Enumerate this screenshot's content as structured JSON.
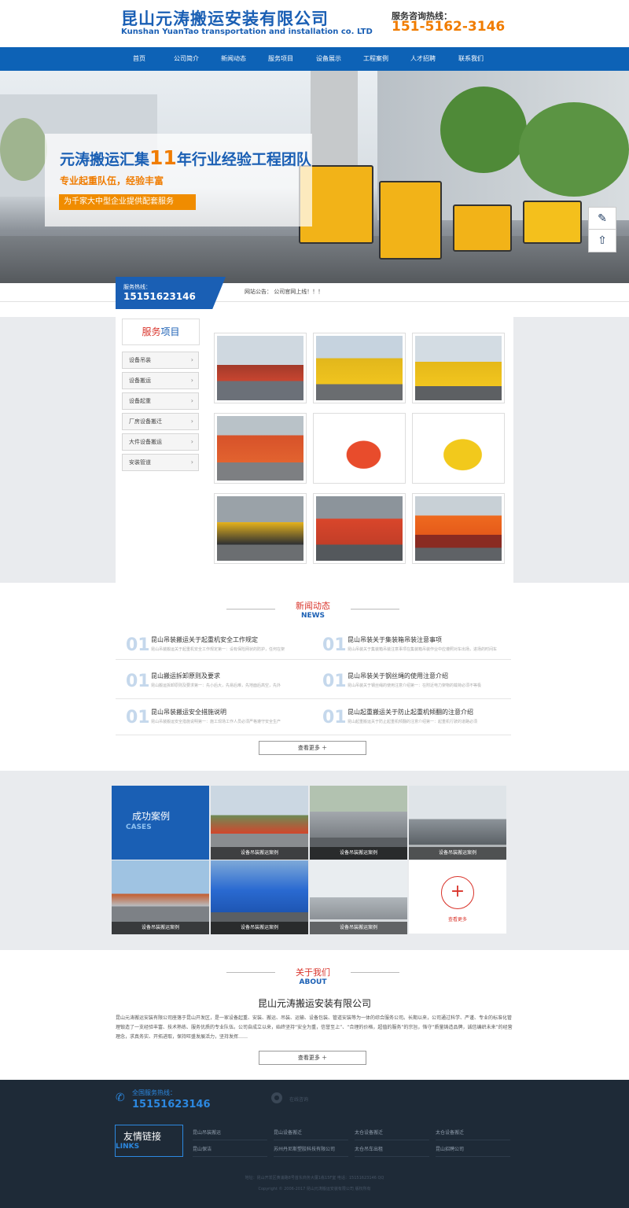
{
  "header": {
    "company_cn": "昆山元涛搬运安装有限公司",
    "company_en": "Kunshan YuanTao transportation and installation co. LTD",
    "hotline_label": "服务咨询热线：",
    "hotline_number": "151-5162-3146"
  },
  "nav": [
    "首页",
    "公司简介",
    "新闻动态",
    "服务项目",
    "设备展示",
    "工程案例",
    "人才招聘",
    "联系我们"
  ],
  "banner": {
    "title_pre": "元涛搬运汇集",
    "title_num": "11",
    "title_post": "年行业经验工程团队",
    "subtitle": "专业起重队伍，经验丰富",
    "badge": "为千家大中型企业提供配套服务"
  },
  "hotline_bar": {
    "label": "服务热线：",
    "number": "15151623146",
    "notice": "网站公告：  公司官网上线！！！"
  },
  "services": {
    "title_red": "服务",
    "title_blue": "项目",
    "items": [
      "设备吊装",
      "设备搬运",
      "设备起重",
      "厂房设备搬迁",
      "大件设备搬运",
      "安装管道"
    ]
  },
  "news": {
    "title_cn": "新闻动态",
    "title_en": "NEWS",
    "items": [
      {
        "num": "01",
        "title": "昆山吊装搬运关于起重机安全工作规定",
        "desc": "昆山吊装搬运关于起重机安全工作规定第一：设有保险网状的防护，任何在架"
      },
      {
        "num": "01",
        "title": "昆山吊装关于集装箱吊装注意事项",
        "desc": "昆山吊装关于集装箱吊装注意事项在集装箱吊装作业中应遵照对车出场，进场的时间车"
      },
      {
        "num": "01",
        "title": "昆山搬运拆卸原则及要求",
        "desc": "昆山搬运拆卸原则及要求第一：先小后大，先易后难，先地面后高空，先外"
      },
      {
        "num": "01",
        "title": "昆山吊装关于钢丝绳的使用注意介绍",
        "desc": "昆山吊装关于钢丝绳的使用注意介绍第一：在附近电力架物的载荷必须不等极"
      },
      {
        "num": "01",
        "title": "昆山吊装搬运安全措施说明",
        "desc": "昆山吊装搬运安全措施说明第一：施工现场工作人员必须严格遵守安全生产"
      },
      {
        "num": "01",
        "title": "昆山起重搬运关于防止起重机倾翻的注意介绍",
        "desc": "昆山起重搬运关于防止起重机倾翻的注意介绍第一：起重机行驶的道路必须"
      }
    ],
    "more": "查看更多  ＋"
  },
  "cases": {
    "title_cn": "成功案例",
    "title_en": "CASES",
    "caption": "设备吊装搬运案例",
    "more": "查看更多"
  },
  "about": {
    "title_cn": "关于我们",
    "title_en": "ABOUT",
    "company": "昆山元涛搬运安装有限公司",
    "text": "昆山元涛搬运安装有限公司座落于昆山开发区，是一家设备起重、安装、搬运、吊装、运输、设备包装、管道安装等为一体的综合服务公司。长期以来，公司通过科学、严谨、专业的标准化管理锻造了一支经验丰富、技术熟练、服务优质的专业队伍。公司自成立以来，始终坚持“安全为重，信誉至上”、“合理的价格，超值的服务”的宗旨，恪守“质量铸造品牌，诚信编织未来”的经营理念，求真务实、开拓进取，保持旺盛发展活力，坚持发挥……",
    "more": "查看更多  ＋"
  },
  "footer": {
    "hotline_label": "全国服务热线：",
    "hotline_number": "15151623146",
    "online": "在线咨询",
    "links_cn": "友情链接",
    "links_en": "LINKS",
    "links": [
      "昆山吊装搬运",
      "昆山设备搬迁",
      "太仓设备搬迁",
      "太仓设备搬迁",
      "昆山保洁",
      "苏州丹尼斯塑胶科技有限公司",
      "太仓吊车出租",
      "昆山招聘公司"
    ],
    "address": "地址：昆山开发区黄浦路8号首东商务大厦1栋15F室     电话：15151623146     QQ",
    "copyright": "Copyright © 2006-2017 昆山元涛搬运安装有限公司 版权所有"
  },
  "colors": {
    "brand_blue": "#1a5fb4",
    "nav_blue": "#0d62b6",
    "accent_orange": "#f07c00",
    "accent_red": "#d9342b",
    "footer_bg": "#1e2a37"
  }
}
